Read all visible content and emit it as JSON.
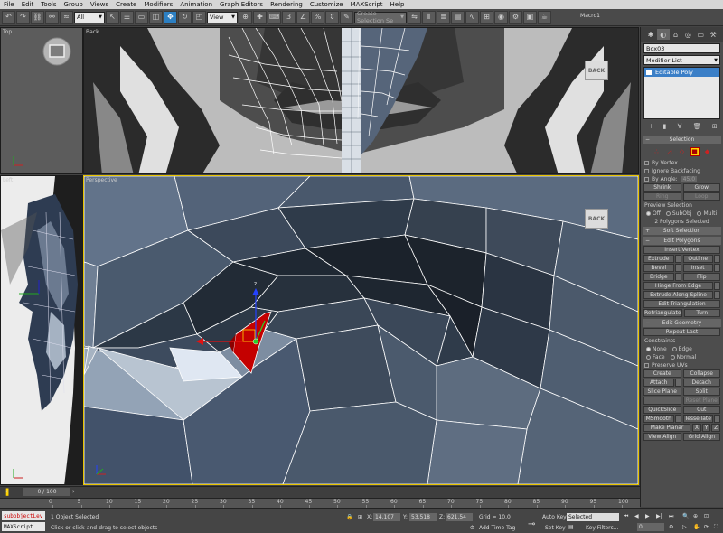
{
  "menu": [
    "File",
    "Edit",
    "Tools",
    "Group",
    "Views",
    "Create",
    "Modifiers",
    "Animation",
    "Graph Editors",
    "Rendering",
    "Customize",
    "MAXScript",
    "Help"
  ],
  "toolbar": {
    "filter_value": "All",
    "refcoord_value": "View",
    "selection_set_placeholder": "Create Selection Se",
    "macro_label": "Macro1"
  },
  "viewports": {
    "top": "Top",
    "back": "Back",
    "left": "Left",
    "perspective": "Perspective",
    "navcube_back": "BACK"
  },
  "command_panel": {
    "object_name": "Box03",
    "modifier_list": "Modifier List",
    "stack_item": "Editable Poly",
    "rollouts": {
      "selection": "Selection",
      "by_vertex": "By Vertex",
      "ignore_backfacing": "Ignore Backfacing",
      "by_angle": "By Angle:",
      "by_angle_value": "45.0",
      "shrink": "Shrink",
      "grow": "Grow",
      "ring": "Ring",
      "loop": "Loop",
      "preview_selection": "Preview Selection",
      "preview_off": "Off",
      "preview_subobj": "SubObj",
      "preview_multi": "Multi",
      "selected_status": "2 Polygons Selected",
      "soft_selection": "Soft Selection",
      "edit_polygons": "Edit Polygons",
      "insert_vertex": "Insert Vertex",
      "extrude": "Extrude",
      "outline": "Outline",
      "bevel": "Bevel",
      "inset": "Inset",
      "bridge": "Bridge",
      "flip": "Flip",
      "hinge_from_edge": "Hinge From Edge",
      "extrude_along_spline": "Extrude Along Spline",
      "edit_triangulation": "Edit Triangulation",
      "retriangulate": "Retriangulate",
      "turn": "Turn",
      "edit_geometry": "Edit Geometry",
      "repeat_last": "Repeat Last",
      "constraints": "Constraints",
      "c_none": "None",
      "c_edge": "Edge",
      "c_face": "Face",
      "c_normal": "Normal",
      "preserve_uvs": "Preserve UVs",
      "create": "Create",
      "collapse": "Collapse",
      "attach": "Attach",
      "detach": "Detach",
      "slice_plane": "Slice Plane",
      "split": "Split",
      "reset_plane": "Reset Plane",
      "quickslice": "QuickSlice",
      "cut": "Cut",
      "msmooth": "MSmooth",
      "tessellate": "Tessellate",
      "make_planar": "Make Planar",
      "x": "X",
      "y": "Y",
      "z": "Z",
      "view_align": "View Align",
      "grid_align": "Grid Align"
    }
  },
  "timeline": {
    "frame_counter": "0 / 100",
    "ticks": [
      "0",
      "5",
      "10",
      "15",
      "20",
      "25",
      "30",
      "35",
      "40",
      "45",
      "50",
      "55",
      "60",
      "65",
      "70",
      "75",
      "80",
      "85",
      "90",
      "95",
      "100"
    ]
  },
  "status": {
    "maxscript_line1": "subobjectLev",
    "maxscript_line2": "MAXScript.",
    "objects_selected": "1 Object Selected",
    "prompt": "Click or click-and-drag to select objects",
    "x_label": "X:",
    "x_value": "14.107",
    "y_label": "Y:",
    "y_value": "53.518",
    "z_label": "Z:",
    "z_value": "621.54",
    "grid": "Grid = 10.0",
    "add_time_tag": "Add Time Tag",
    "auto_key": "Auto Key",
    "auto_key_value": "Selected",
    "set_key": "Set Key",
    "key_filters": "Key Filters...",
    "current_frame": "0"
  },
  "colors": {
    "selection_red": "#c40000",
    "active_blue": "#2c7fc2",
    "viewport_highlight": "#e8c400"
  }
}
